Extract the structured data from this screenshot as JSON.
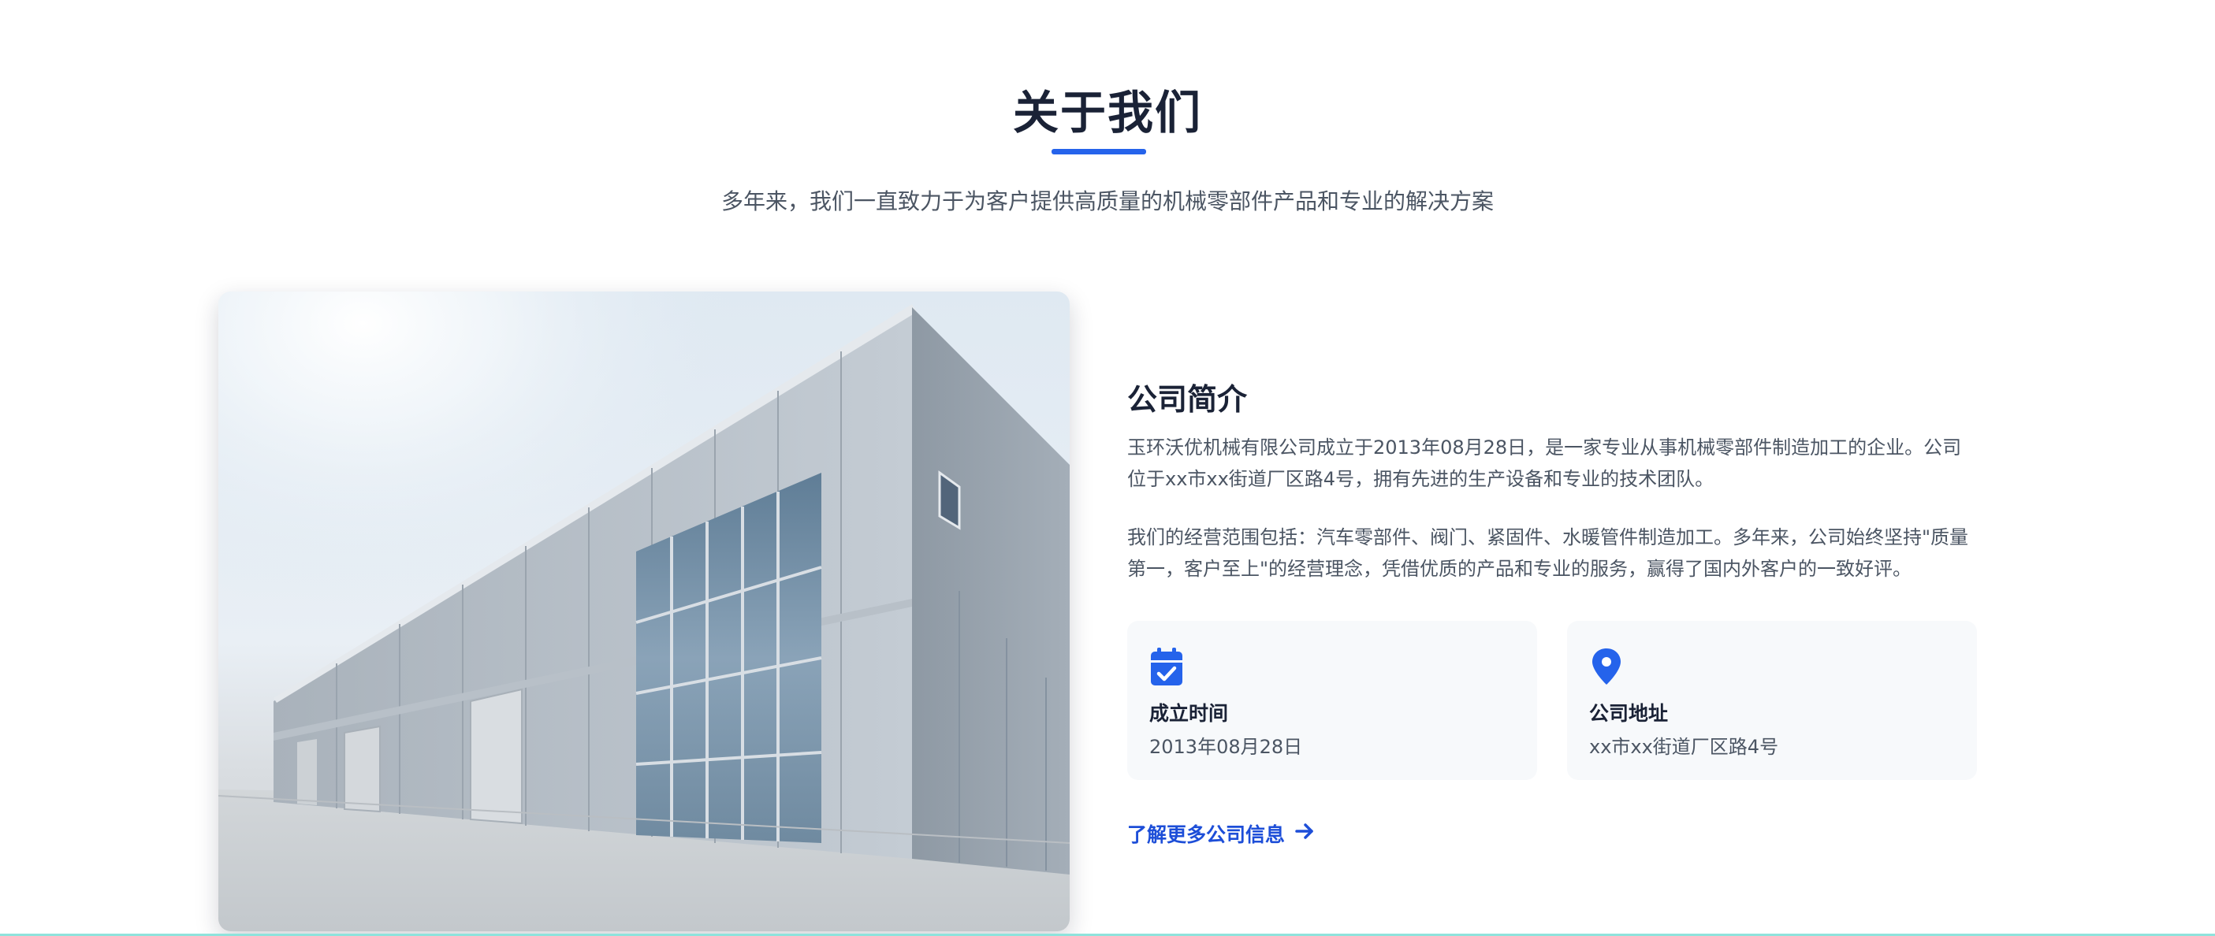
{
  "section": {
    "title": "关于我们",
    "subtitle": "多年来，我们一直致力于为客户提供高质量的机械零部件产品和专业的解决方案"
  },
  "intro": {
    "heading": "公司简介",
    "paragraph_1": "玉环沃优机械有限公司成立于2013年08月28日，是一家专业从事机械零部件制造加工的企业。公司位于xx市xx街道厂区路4号，拥有先进的生产设备和专业的技术团队。",
    "paragraph_2": "我们的经营范围包括：汽车零部件、阀门、紧固件、水暖管件制造加工。多年来，公司始终坚持\"质量第一，客户至上\"的经营理念，凭借优质的产品和专业的服务，赢得了国内外客户的一致好评。"
  },
  "cards": [
    {
      "icon": "calendar-check-icon",
      "label": "成立时间",
      "value": "2013年08月28日"
    },
    {
      "icon": "map-pin-icon",
      "label": "公司地址",
      "value": "xx市xx街道厂区路4号"
    }
  ],
  "link": {
    "label": "了解更多公司信息",
    "icon": "arrow-right-icon"
  },
  "colors": {
    "accent": "#2563eb",
    "heading": "#1a2236",
    "body_text": "#4b5563",
    "card_bg": "#f7f9fb"
  }
}
